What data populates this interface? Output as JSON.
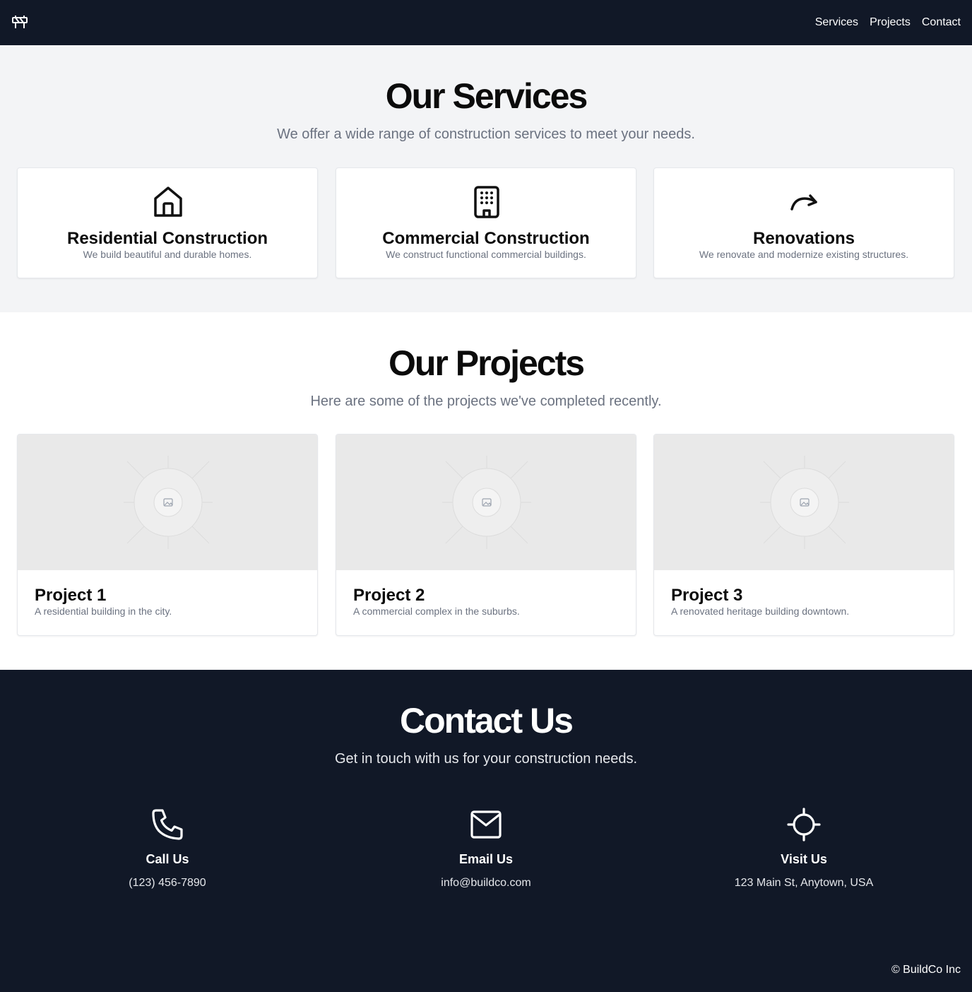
{
  "header": {
    "logo_icon": "construction-barrier-icon",
    "nav": [
      {
        "label": "Services"
      },
      {
        "label": "Projects"
      },
      {
        "label": "Contact"
      }
    ]
  },
  "services": {
    "title": "Our Services",
    "subtitle": "We offer a wide range of construction services to meet your needs.",
    "items": [
      {
        "icon": "home-icon",
        "title": "Residential Construction",
        "desc": "We build beautiful and durable homes."
      },
      {
        "icon": "building-icon",
        "title": "Commercial Construction",
        "desc": "We construct functional commercial buildings."
      },
      {
        "icon": "redo-arrow-icon",
        "title": "Renovations",
        "desc": "We renovate and modernize existing structures."
      }
    ]
  },
  "projects": {
    "title": "Our Projects",
    "subtitle": "Here are some of the projects we've completed recently.",
    "items": [
      {
        "image_icon": "image-placeholder-icon",
        "title": "Project 1",
        "desc": "A residential building in the city."
      },
      {
        "image_icon": "image-placeholder-icon",
        "title": "Project 2",
        "desc": "A commercial complex in the suburbs."
      },
      {
        "image_icon": "image-placeholder-icon",
        "title": "Project 3",
        "desc": "A renovated heritage building downtown."
      }
    ]
  },
  "contact": {
    "title": "Contact Us",
    "subtitle": "Get in touch with us for your construction needs.",
    "items": [
      {
        "icon": "phone-icon",
        "label": "Call Us",
        "value": "(123) 456-7890"
      },
      {
        "icon": "mail-icon",
        "label": "Email Us",
        "value": "info@buildco.com"
      },
      {
        "icon": "location-crosshair-icon",
        "label": "Visit Us",
        "value": "123 Main St, Anytown, USA"
      }
    ]
  },
  "footer": {
    "copyright": "© BuildCo Inc"
  },
  "colors": {
    "dark": "#111827",
    "light_section": "#f3f4f6",
    "muted_text": "#6b7280"
  }
}
